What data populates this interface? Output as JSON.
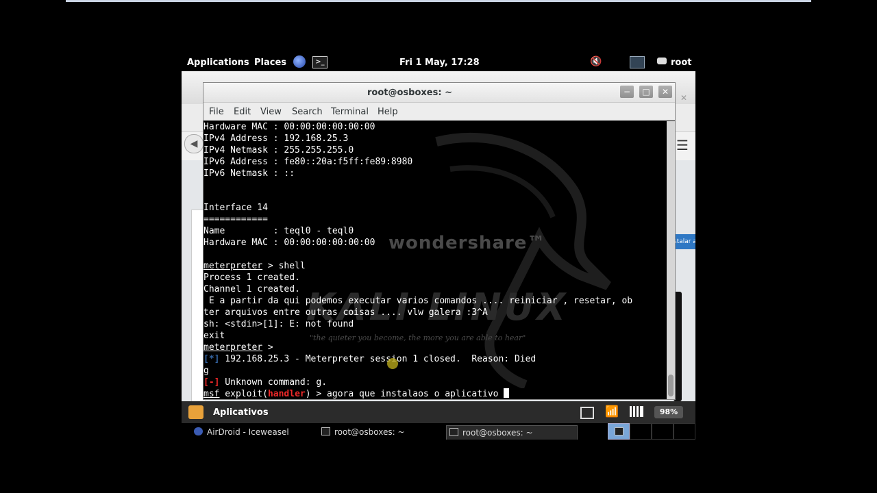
{
  "topbar": {
    "applications": "Applications",
    "places": "Places",
    "clock": "Fri  1 May, 17:28",
    "user": "root"
  },
  "background_browser": {
    "side_label": "stalar a"
  },
  "terminal": {
    "title": "root@osboxes: ~",
    "window_buttons": [
      "−",
      "□",
      "✕"
    ],
    "menu": [
      "File",
      "Edit",
      "View",
      "Search",
      "Terminal",
      "Help"
    ],
    "lines": [
      "Hardware MAC : 00:00:00:00:00:00",
      "IPv4 Address : 192.168.25.3",
      "IPv4 Netmask : 255.255.255.0",
      "IPv6 Address : fe80::20a:f5ff:fe89:8980",
      "IPv6 Netmask : ::",
      "",
      "",
      "Interface 14",
      "============",
      "Name         : teql0 - teql0",
      "Hardware MAC : 00:00:00:00:00:00",
      "",
      "meterpreter > shell",
      "Process 1 created.",
      "Channel 1 created.",
      " E a partir da qui podemos executar varios comandos .... reiniciar , resetar, ob",
      "ter arquivos entre outras coisas .... vlw galera :3^A",
      "sh: <stdin>[1]: E: not found",
      "exit",
      "meterpreter >",
      "[*] 192.168.25.3 - Meterpreter session 1 closed.  Reason: Died",
      "g",
      "[-] Unknown command: g.",
      "msf exploit(handler) > agora que instalaos o aplicativo "
    ],
    "prompt_meterpreter": "meterpreter",
    "prompt_tail_shell": " > shell",
    "prompt_tail_empty": " >",
    "info_tag": "[*]",
    "info_text": " 192.168.25.3 - Meterpreter session 1 closed.  Reason: Died",
    "err_tag": "[-]",
    "err_text": " Unknown command: g.",
    "msf": "msf",
    "exploit": " exploit(",
    "handler": "handler",
    "msf_tail": ") > agora que instalaos o aplicativo "
  },
  "watermarks": {
    "wondershare": "wondershare™",
    "kali": "KALI LINUX",
    "tm": "™",
    "quote": "\"the quieter you become, the more you are able to hear\""
  },
  "bottom_panel": {
    "apps_label": "Aplicativos",
    "battery": "98%"
  },
  "taskbar": {
    "items": [
      "AirDroid - Iceweasel",
      "root@osboxes: ~",
      "root@osboxes: ~"
    ]
  }
}
